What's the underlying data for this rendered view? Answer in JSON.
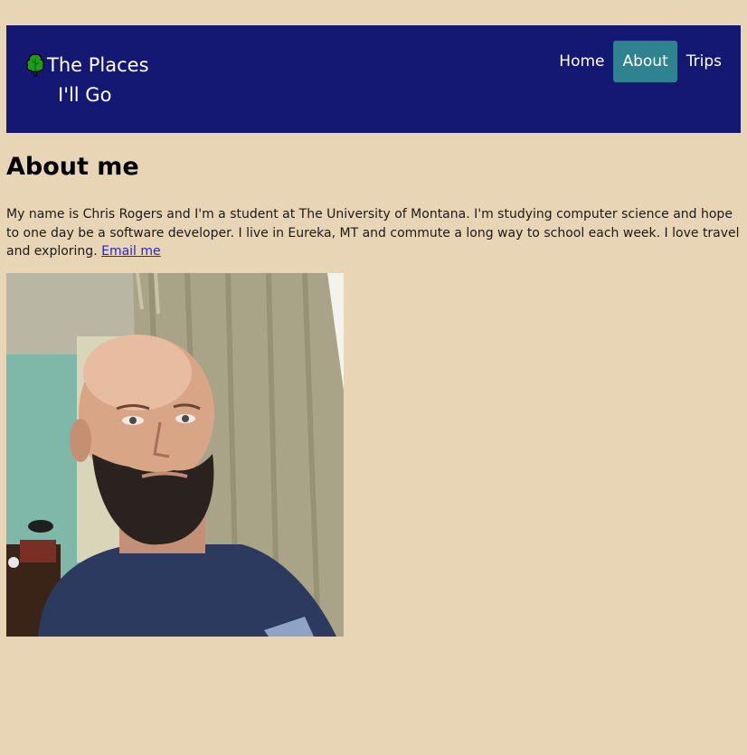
{
  "header": {
    "logo_icon": "tree-icon",
    "title_line1": "The Places",
    "title_line2": "I'll Go",
    "background": "#141873"
  },
  "nav": {
    "items": [
      {
        "label": "Home",
        "active": false
      },
      {
        "label": "About",
        "active": true
      },
      {
        "label": "Trips",
        "active": false
      }
    ],
    "active_color": "#2f8390"
  },
  "main": {
    "heading": "About me",
    "bio_text": "My name is Chris Rogers and I'm a student at The University of Montana. I'm studying computer science and hope to one day be a software developer. I live in Eureka, MT and commute a long way to school each week. I love travel and exploring. ",
    "email_link": "Email me",
    "photo_icon": "profile-photo"
  },
  "page": {
    "background": "#e8d5b5"
  }
}
